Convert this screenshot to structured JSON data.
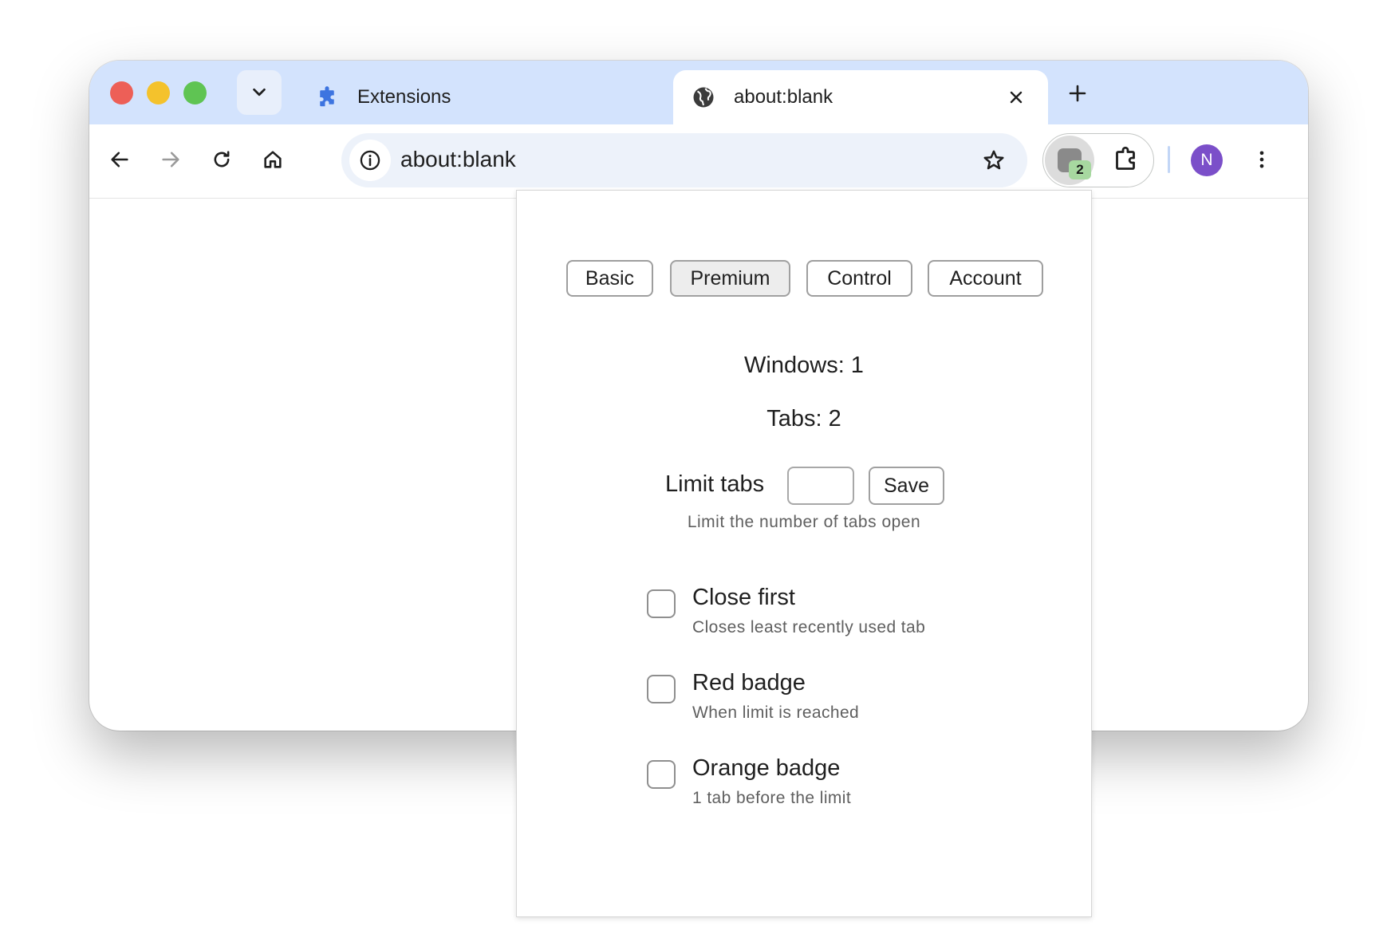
{
  "tabs": [
    {
      "title": "Extensions",
      "icon": "puzzle-icon",
      "active": false
    },
    {
      "title": "about:blank",
      "icon": "globe-icon",
      "active": true
    }
  ],
  "omnibox": {
    "url": "about:blank"
  },
  "extension": {
    "badge_count": "2"
  },
  "profile": {
    "initial": "N",
    "color": "#7b4fc9"
  },
  "popup": {
    "nav": [
      "Basic",
      "Premium",
      "Control",
      "Account"
    ],
    "active_nav": "Premium",
    "windows_text": "Windows: 1",
    "tabs_text": "Tabs: 2",
    "limit": {
      "label": "Limit tabs",
      "value": "",
      "save_label": "Save",
      "hint": "Limit the number of tabs open"
    },
    "options": [
      {
        "title": "Close first",
        "desc": "Closes least recently used tab",
        "checked": false
      },
      {
        "title": "Red badge",
        "desc": "When limit is reached",
        "checked": false
      },
      {
        "title": "Orange badge",
        "desc": "1 tab before the limit",
        "checked": false
      }
    ]
  },
  "colors": {
    "tabstrip": "#d3e3fd",
    "omnibox": "#edf2fa",
    "badge": "#a7d8a0"
  }
}
